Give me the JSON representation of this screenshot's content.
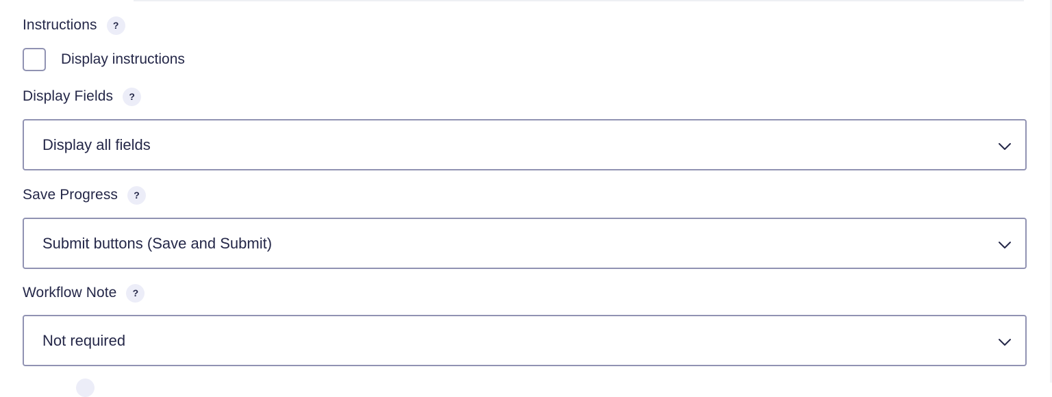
{
  "instructions": {
    "label": "Instructions",
    "help": "?",
    "checkbox_label": "Display instructions",
    "checked": false
  },
  "display_fields": {
    "label": "Display Fields",
    "help": "?",
    "value": "Display all fields"
  },
  "save_progress": {
    "label": "Save Progress",
    "help": "?",
    "value": "Submit buttons (Save and Submit)"
  },
  "workflow_note": {
    "label": "Workflow Note",
    "help": "?",
    "value": "Not required"
  },
  "colors": {
    "text": "#242748",
    "border": "#9092b2",
    "help_bg": "#ecedf8"
  }
}
